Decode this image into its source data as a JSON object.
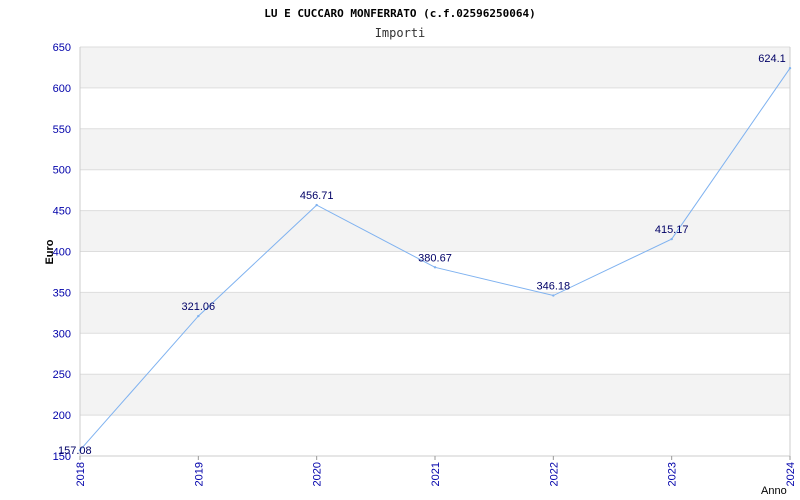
{
  "colors": {
    "line": "#7fb2f0",
    "band": "#f3f3f3",
    "grid": "#dddddd",
    "tick_text": "#0000aa",
    "data_label": "#000066"
  },
  "chart_data": {
    "type": "line",
    "title": "LU E CUCCARO MONFERRATO (c.f.02596250064)",
    "subtitle": "Importi",
    "ylabel": "Euro",
    "xlabel": "Anno",
    "ylim": [
      150,
      650
    ],
    "yticks": [
      150,
      200,
      250,
      300,
      350,
      400,
      450,
      500,
      550,
      600,
      650
    ],
    "grid": true,
    "categories": [
      "2018",
      "2019",
      "2020",
      "2021",
      "2022",
      "2023",
      "2024"
    ],
    "values": [
      157.08,
      321.06,
      456.71,
      380.67,
      346.18,
      415.17,
      624.1
    ],
    "labels": [
      "157.08",
      "321.06",
      "456.71",
      "380.67",
      "346.18",
      "415.17",
      "624.1"
    ]
  }
}
